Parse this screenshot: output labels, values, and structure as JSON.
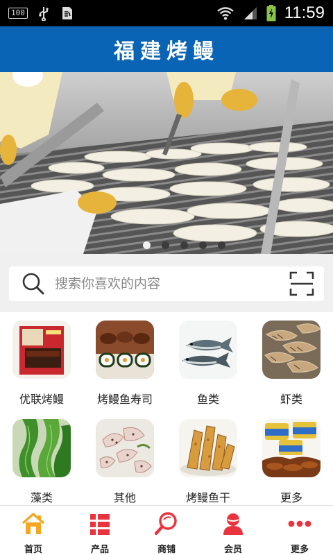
{
  "status_bar": {
    "battery_percent": "100",
    "time": "11:59",
    "accent_color": "#8bc34a"
  },
  "header": {
    "title": "福建烤鳗",
    "background_color": "#0a64b5"
  },
  "banner": {
    "slide_count": 5,
    "active_slide_index": 0
  },
  "search": {
    "placeholder": "搜索你喜欢的内容"
  },
  "categories": [
    {
      "label": "优联烤鳗",
      "icon": "eel-package-photo"
    },
    {
      "label": "烤鳗鱼寿司",
      "icon": "eel-sushi-photo"
    },
    {
      "label": "鱼类",
      "icon": "fish-photo"
    },
    {
      "label": "虾类",
      "icon": "shrimp-photo"
    },
    {
      "label": "藻类",
      "icon": "seaweed-photo"
    },
    {
      "label": "其他",
      "icon": "squid-photo"
    },
    {
      "label": "烤鳗鱼干",
      "icon": "dried-fish-photo"
    },
    {
      "label": "更多",
      "icon": "canned-food-photo"
    }
  ],
  "bottom_nav": {
    "items": [
      {
        "label": "首页",
        "icon": "home-icon",
        "color": "#f5a623"
      },
      {
        "label": "产品",
        "icon": "product-grid-icon",
        "color": "#e8343e"
      },
      {
        "label": "商铺",
        "icon": "shop-search-icon",
        "color": "#e8343e"
      },
      {
        "label": "会员",
        "icon": "member-icon",
        "color": "#e8343e"
      },
      {
        "label": "更多",
        "icon": "more-icon",
        "color": "#e8343e"
      }
    ]
  }
}
